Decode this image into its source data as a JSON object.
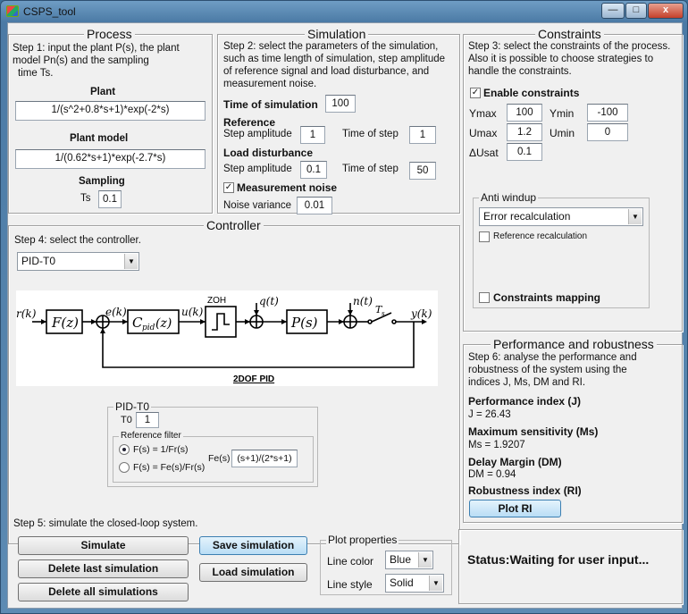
{
  "window": {
    "title": "CSPS_tool",
    "min": "—",
    "max": "□",
    "close": "x"
  },
  "process": {
    "title": "Process",
    "step1": [
      "Step 1: input the plant P(s), the plant",
      "model Pn(s) and the sampling",
      "time Ts."
    ],
    "plant_label": "Plant",
    "plant_value": "1/(s^2+0.8*s+1)*exp(-2*s)",
    "model_label": "Plant model",
    "model_value": "1/(0.62*s+1)*exp(-2.7*s)",
    "sampling_label": "Sampling",
    "ts_label": "Ts",
    "ts_value": "0.1"
  },
  "simulation": {
    "title": "Simulation",
    "step2": [
      "Step 2: select the parameters of the simulation,",
      "such as time length of simulation, step amplitude",
      "of reference  signal and load disturbance, and",
      "measurement noise."
    ],
    "time_label": "Time of simulation",
    "time_value": "100",
    "reference_label": "Reference",
    "ref_amp_label": "Step amplitude",
    "ref_amp_value": "1",
    "ref_time_label": "Time of step",
    "ref_time_value": "1",
    "load_label": "Load disturbance",
    "load_amp_label": "Step amplitude",
    "load_amp_value": "0.1",
    "load_time_label": "Time of step",
    "load_time_value": "50",
    "noise_label": "Measurement noise",
    "noise_check": "✓",
    "variance_label": "Noise variance",
    "variance_value": "0.01"
  },
  "constraints": {
    "title": "Constraints",
    "step3": [
      "Step 3: select the constraints of the process.",
      "Also it is possible to choose strategies to",
      "handle the constraints."
    ],
    "enable_label": "Enable constraints",
    "enable_check": "✓",
    "ymax_label": "Ymax",
    "ymax_value": "100",
    "ymin_label": "Ymin",
    "ymin_value": "-100",
    "umax_label": "Umax",
    "umax_value": "1.2",
    "umin_label": "Umin",
    "umin_value": "0",
    "dusat_label": "ΔUsat",
    "dusat_value": "0.1",
    "antiwindup_title": "Anti windup",
    "antiwindup_value": "Error recalculation",
    "ref_recalc_label": "Reference recalculation",
    "mapping_label": "Constraints mapping"
  },
  "controller": {
    "title": "Controller",
    "step4": "Step 4: select the controller.",
    "select_value": "PID-T0",
    "diagram": {
      "r": "r(k)",
      "F": "F(z)",
      "e": "e(k)",
      "C": "C",
      "pid": "pid",
      "Cz": "(z)",
      "u": "u(k)",
      "zoh": "ZOH",
      "q": "q(t)",
      "P": "P(s)",
      "n": "n(t)",
      "ts": "T",
      "tss": "s",
      "y": "y(k)",
      "caption": "2DOF PID"
    },
    "pidt0": {
      "title": "PID-T0",
      "t0_label": "T0",
      "t0_value": "1",
      "filter_title": "Reference filter",
      "opt1": "F(s) = 1/Fr(s)",
      "opt2": "F(s) = Fe(s)/Fr(s)",
      "fe_label": "Fe(s)",
      "fe_value": "(s+1)/(2*s+1)"
    }
  },
  "performance": {
    "title": "Performance and robustness",
    "step6": [
      "Step 6: analyse the performance and",
      "robustness of the system using the",
      "indices J, Ms, DM and RI."
    ],
    "j_title": "Performance index (J)",
    "j_value": "J =  26.43",
    "ms_title": "Maximum sensitivity (Ms)",
    "ms_value": "Ms =  1.9207",
    "dm_title": "Delay Margin (DM)",
    "dm_value": "DM =  0.94",
    "ri_title": "Robustness index (RI)",
    "plot_ri": "Plot RI"
  },
  "step5": "Step 5: simulate the closed-loop system.",
  "buttons": {
    "simulate": "Simulate",
    "delete_last": "Delete last simulation",
    "delete_all": "Delete all simulations",
    "save": "Save simulation",
    "load": "Load simulation"
  },
  "plot_props": {
    "title": "Plot properties",
    "color_label": "Line color",
    "color_value": "Blue",
    "style_label": "Line style",
    "style_value": "Solid"
  },
  "status": "Status:Waiting for user input..."
}
